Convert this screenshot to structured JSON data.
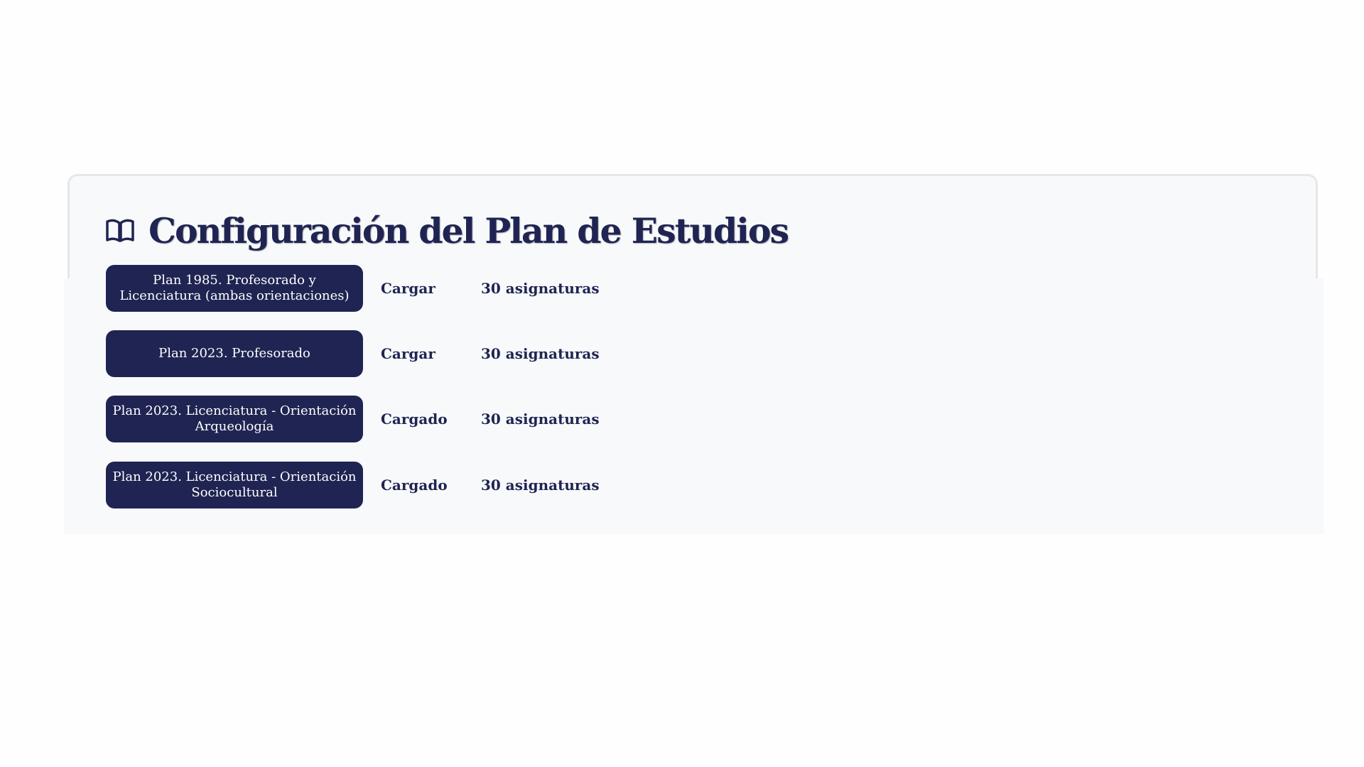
{
  "header": {
    "title": "Configuración del Plan de Estudios",
    "icon": "book-open-icon"
  },
  "plans": [
    {
      "label": "Plan 1985. Profesorado y Licenciatura (ambas orientaciones)",
      "status": "Cargar",
      "count": "30 asignaturas"
    },
    {
      "label": "Plan 2023. Profesorado",
      "status": "Cargar",
      "count": "30 asignaturas"
    },
    {
      "label": "Plan 2023. Licenciatura - Orientación Arqueología",
      "status": "Cargado",
      "count": "30 asignaturas"
    },
    {
      "label": "Plan 2023. Licenciatura - Orientación Sociocultural",
      "status": "Cargado",
      "count": "30 asignaturas"
    }
  ],
  "colors": {
    "primary": "#1f2452",
    "card_background": "#f8f9fa",
    "page_background": "#fefefe"
  }
}
